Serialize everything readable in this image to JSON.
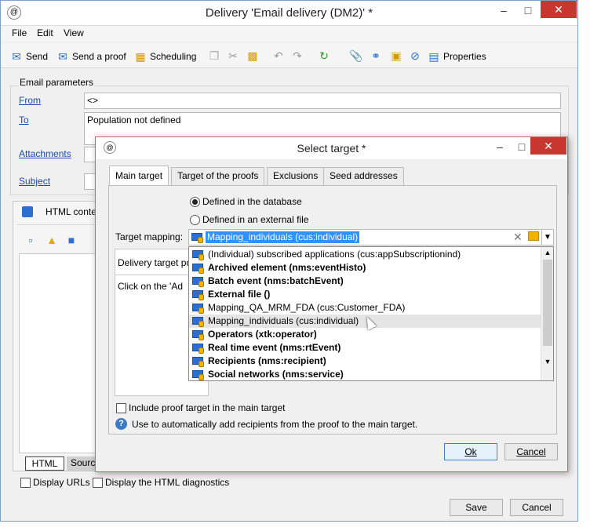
{
  "window": {
    "title": "Delivery 'Email delivery (DM2)' *",
    "menu": [
      "File",
      "Edit",
      "View"
    ],
    "toolbar": {
      "send": "Send",
      "send_proof": "Send a proof",
      "scheduling": "Scheduling",
      "properties": "Properties"
    }
  },
  "email_params": {
    "group_label": "Email parameters",
    "from_label": "From",
    "from_value": "<>",
    "to_label": "To",
    "to_value": "Population not defined",
    "attachments_label": "Attachments",
    "subject_label": "Subject"
  },
  "html_section": {
    "header": "HTML conte",
    "tab_html": "HTML",
    "tab_source": "Sourc"
  },
  "bottom": {
    "display_urls": "Display URLs",
    "display_diag": "Display the HTML diagnostics",
    "save": "Save",
    "cancel": "Cancel"
  },
  "dialog": {
    "title": "Select target *",
    "tabs": [
      "Main target",
      "Target of the proofs",
      "Exclusions",
      "Seed addresses"
    ],
    "radio_db": "Defined in the database",
    "radio_ext": "Defined in an external file",
    "mapping_label": "Target mapping:",
    "mapping_value": "Mapping_individuals (cus:individual)",
    "delivery_target_label": "Delivery target po",
    "click_text": "Click on the 'Ad",
    "include_proof": "Include proof target in the main target",
    "help_text": "Use to automatically add recipients from the proof to the main target.",
    "ok": "Ok",
    "cancel": "Cancel",
    "options": [
      {
        "label": "(Individual) subscribed applications (cus:appSubscriptionind)",
        "bold": false
      },
      {
        "label": "Archived element (nms:eventHisto)",
        "bold": true
      },
      {
        "label": "Batch event (nms:batchEvent)",
        "bold": true
      },
      {
        "label": "External file ()",
        "bold": true
      },
      {
        "label": "Mapping_QA_MRM_FDA (cus:Customer_FDA)",
        "bold": false
      },
      {
        "label": "Mapping_individuals (cus:individual)",
        "bold": false
      },
      {
        "label": "Operators (xtk:operator)",
        "bold": true
      },
      {
        "label": "Real time event (nms:rtEvent)",
        "bold": true
      },
      {
        "label": "Recipients (nms:recipient)",
        "bold": true
      },
      {
        "label": "Social networks (nms:service)",
        "bold": true
      }
    ]
  }
}
